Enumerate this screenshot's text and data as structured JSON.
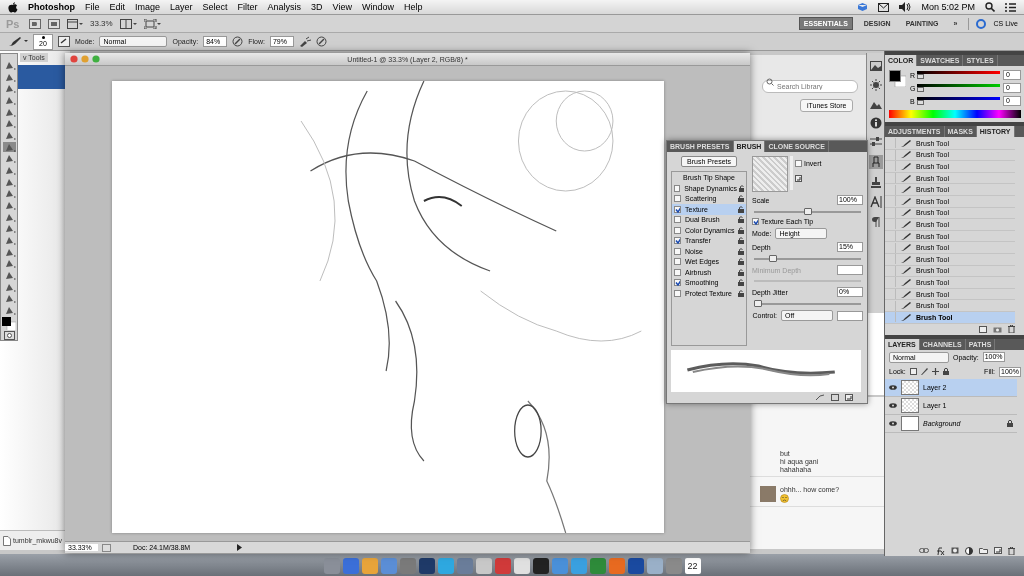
{
  "menu_bar": {
    "app": "Photoshop",
    "items": [
      "File",
      "Edit",
      "Image",
      "Layer",
      "Select",
      "Filter",
      "Analysis",
      "3D",
      "View",
      "Window",
      "Help"
    ],
    "clock": "Mon 5:02 PM"
  },
  "app_bar": {
    "logo": "Ps",
    "zoom": "33.3%",
    "workspaces": [
      {
        "label": "ESSENTIALS",
        "selected": true
      },
      {
        "label": "DESIGN",
        "selected": false
      },
      {
        "label": "PAINTING",
        "selected": false
      }
    ],
    "more": "»",
    "cs_live": "CS Live"
  },
  "options_bar": {
    "brush_size": "20",
    "mode_label": "Mode:",
    "mode": "Normal",
    "opacity_label": "Opacity:",
    "opacity": "84%",
    "flow_label": "Flow:",
    "flow": "79%"
  },
  "toolbox": {
    "tools": [
      {
        "selected": false
      },
      {
        "selected": false
      },
      {
        "selected": false
      },
      {
        "selected": false
      },
      {
        "selected": false
      },
      {
        "selected": false
      },
      {
        "selected": false
      },
      {
        "selected": true
      },
      {
        "selected": false
      },
      {
        "selected": false
      },
      {
        "selected": false
      },
      {
        "selected": false
      },
      {
        "selected": false
      },
      {
        "selected": false
      },
      {
        "selected": false
      },
      {
        "selected": false
      },
      {
        "selected": false
      },
      {
        "selected": false
      },
      {
        "selected": false
      },
      {
        "selected": false
      },
      {
        "selected": false
      },
      {
        "selected": false
      }
    ]
  },
  "background_window": {
    "toolbar_text": "v Tools",
    "download": "tumblr_mkwu8v"
  },
  "document": {
    "title": "Untitled-1 @ 33.3% (Layer 2, RGB/8) *",
    "zoom": "33.33%",
    "doc_size": "Doc: 24.1M/38.8M"
  },
  "itunes": {
    "search_placeholder": "Search Library",
    "store_button": "iTunes Store"
  },
  "chat": {
    "messages": [
      {
        "lines": [
          "but",
          "hi aqua gani",
          "hahahaha"
        ],
        "emoji": false
      },
      {
        "lines": [
          "ohhh... how come?"
        ],
        "emoji": true
      }
    ]
  },
  "brush_panel": {
    "tabs": [
      {
        "label": "BRUSH PRESETS",
        "selected": false
      },
      {
        "label": "BRUSH",
        "selected": true
      },
      {
        "label": "CLONE SOURCE",
        "selected": false
      }
    ],
    "presets_button": "Brush Presets",
    "tip_shape": "Brush Tip Shape",
    "options": [
      {
        "label": "Shape Dynamics",
        "checked": false,
        "selected": false
      },
      {
        "label": "Scattering",
        "checked": false,
        "selected": false
      },
      {
        "label": "Texture",
        "checked": true,
        "selected": true
      },
      {
        "label": "Dual Brush",
        "checked": false,
        "selected": false
      },
      {
        "label": "Color Dynamics",
        "checked": false,
        "selected": false
      },
      {
        "label": "Transfer",
        "checked": true,
        "selected": false
      },
      {
        "label": "Noise",
        "checked": false,
        "selected": false
      },
      {
        "label": "Wet Edges",
        "checked": false,
        "selected": false
      },
      {
        "label": "Airbrush",
        "checked": false,
        "selected": false
      },
      {
        "label": "Smoothing",
        "checked": true,
        "selected": false
      },
      {
        "label": "Protect Texture",
        "checked": false,
        "selected": false
      }
    ],
    "invert": {
      "label": "Invert",
      "checked": false
    },
    "scale": {
      "label": "Scale",
      "value": "100%",
      "level": 0.5
    },
    "texture_each_tip": {
      "label": "Texture Each Tip",
      "checked": true
    },
    "mode": {
      "label": "Mode:",
      "value": "Height"
    },
    "depth": {
      "label": "Depth",
      "value": "15%",
      "level": 0.15
    },
    "minimum_depth": {
      "label": "Minimum Depth",
      "disabled": true
    },
    "depth_jitter": {
      "label": "Depth Jitter",
      "value": "0%",
      "level": 0
    },
    "control": {
      "label": "Control:",
      "value": "Off"
    }
  },
  "color_panel": {
    "tabs": [
      {
        "label": "COLOR",
        "selected": true
      },
      {
        "label": "SWATCHES",
        "selected": false
      },
      {
        "label": "STYLES",
        "selected": false
      }
    ],
    "channels": [
      {
        "label": "R",
        "value": "0",
        "level": 0,
        "kind": "red"
      },
      {
        "label": "G",
        "value": "0",
        "level": 0,
        "kind": "green"
      },
      {
        "label": "B",
        "value": "0",
        "level": 0,
        "kind": "blue"
      }
    ]
  },
  "history_panel": {
    "tabs": [
      {
        "label": "ADJUSTMENTS",
        "selected": false
      },
      {
        "label": "MASKS",
        "selected": false
      },
      {
        "label": "HISTORY",
        "selected": true
      }
    ],
    "states": [
      {
        "label": "Brush Tool",
        "selected": false
      },
      {
        "label": "Brush Tool",
        "selected": false
      },
      {
        "label": "Brush Tool",
        "selected": false
      },
      {
        "label": "Brush Tool",
        "selected": false
      },
      {
        "label": "Brush Tool",
        "selected": false
      },
      {
        "label": "Brush Tool",
        "selected": false
      },
      {
        "label": "Brush Tool",
        "selected": false
      },
      {
        "label": "Brush Tool",
        "selected": false
      },
      {
        "label": "Brush Tool",
        "selected": false
      },
      {
        "label": "Brush Tool",
        "selected": false
      },
      {
        "label": "Brush Tool",
        "selected": false
      },
      {
        "label": "Brush Tool",
        "selected": false
      },
      {
        "label": "Brush Tool",
        "selected": false
      },
      {
        "label": "Brush Tool",
        "selected": false
      },
      {
        "label": "Brush Tool",
        "selected": false
      },
      {
        "label": "Brush Tool",
        "selected": true
      }
    ]
  },
  "layers_panel": {
    "tabs": [
      {
        "label": "LAYERS",
        "selected": true
      },
      {
        "label": "CHANNELS",
        "selected": false
      },
      {
        "label": "PATHS",
        "selected": false
      }
    ],
    "blend_mode": "Normal",
    "opacity_label": "Opacity:",
    "opacity": "100%",
    "lock_label": "Lock:",
    "fill_label": "Fill:",
    "fill": "100%",
    "layers": [
      {
        "name": "Layer 2",
        "selected": true,
        "kind": "transparent",
        "locked": false
      },
      {
        "name": "Layer 1",
        "selected": false,
        "kind": "transparent",
        "locked": false
      },
      {
        "name": "Background",
        "selected": false,
        "kind": "white",
        "locked": true
      }
    ]
  },
  "dock": {
    "apps": [
      {
        "color": "#8a8f99"
      },
      {
        "color": "#3b6fd8"
      },
      {
        "color": "#e8a43a"
      },
      {
        "color": "#5b8ed6"
      },
      {
        "color": "#7a7a7a"
      },
      {
        "color": "#1f3a68"
      },
      {
        "color": "#2ea8e0"
      },
      {
        "color": "#6a7d9a"
      },
      {
        "color": "#c8c8c8"
      },
      {
        "color": "#d03a3a"
      },
      {
        "color": "#e0e0e0"
      },
      {
        "color": "#222222"
      },
      {
        "color": "#4a90d9"
      },
      {
        "color": "#3aa0e0"
      },
      {
        "color": "#2e8b3a"
      },
      {
        "color": "#e86a20"
      },
      {
        "color": "#1a4aa0"
      },
      {
        "color": "#9ab0c8"
      },
      {
        "color": "#8a8a8a"
      }
    ],
    "calendar_day": "22"
  }
}
